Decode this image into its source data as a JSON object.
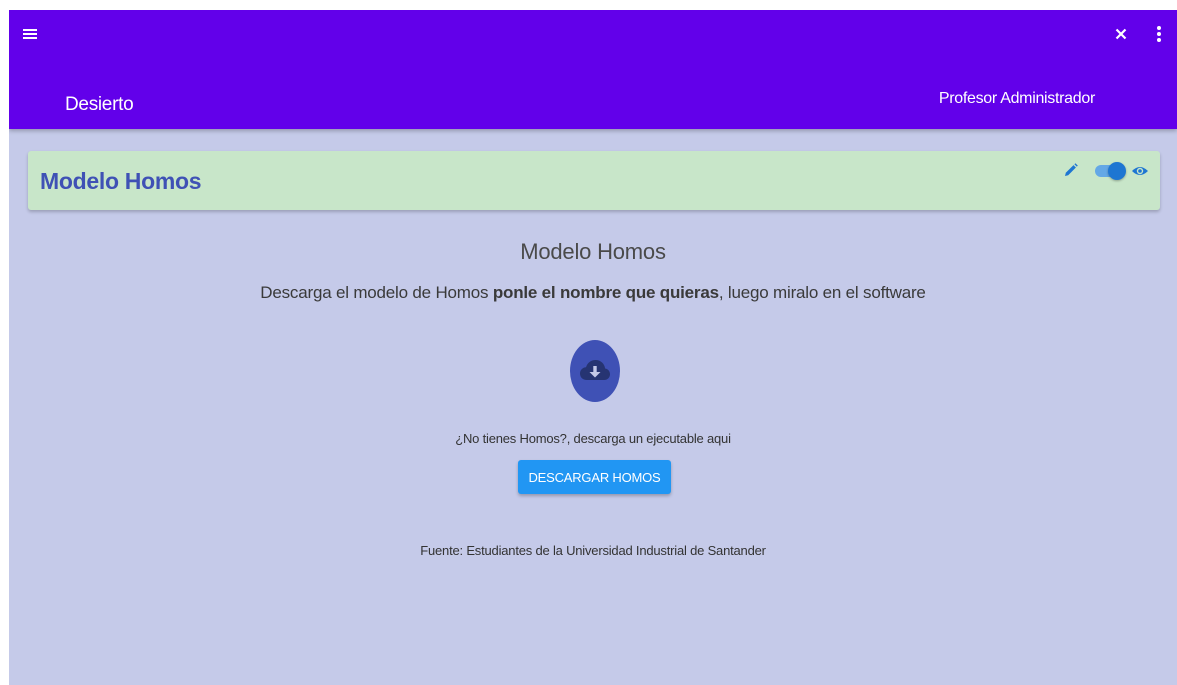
{
  "appbar": {
    "title": "Desierto",
    "user": "Profesor Administrador",
    "color": "#6200ea",
    "icons": [
      "menu-icon",
      "close-icon",
      "more-vert-icon"
    ]
  },
  "card": {
    "title": "Modelo Homos",
    "color": "#c8e6c9",
    "title_color": "#3f51b5",
    "visible_toggle_on": true,
    "icons": [
      "pencil-icon",
      "toggle-switch",
      "eye-icon"
    ]
  },
  "content": {
    "title": "Modelo Homos",
    "desc_prefix": "Descarga el modelo de Homos ",
    "desc_bold": "ponle el nombre que quieras",
    "desc_suffix": ", luego miralo en el software",
    "download_icon": "cloud-download-icon",
    "no_homos_text": "¿No tienes Homos?, descarga un ejecutable aqui",
    "download_button_label": "DESCARGAR HOMOS",
    "source_text": "Fuente: Estudiantes de la Universidad Industrial de Santander"
  },
  "colors": {
    "background": "#c5cae9",
    "accent_button": "#2196f3",
    "download_circle": "#3f51b5",
    "toggle": "#1e76d2"
  }
}
